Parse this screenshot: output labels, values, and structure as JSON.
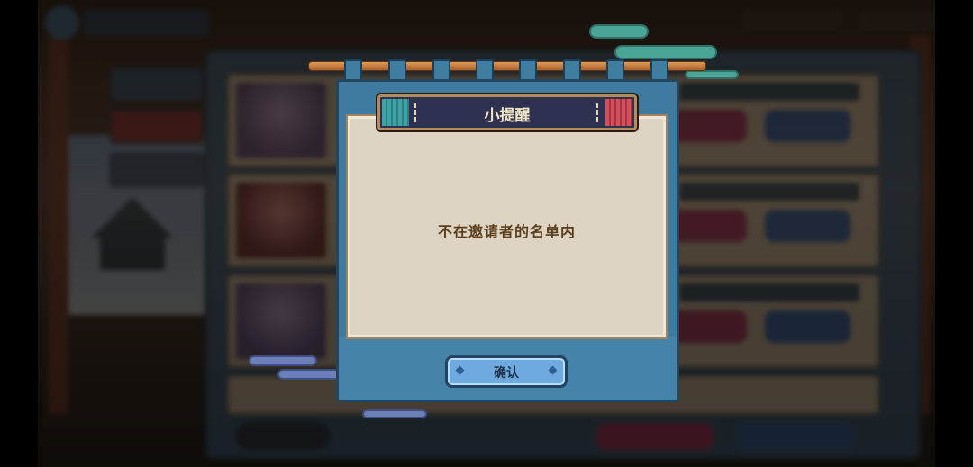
{
  "dialog": {
    "title": "小提醒",
    "message": "不在邀请者的名单内",
    "confirm_label": "确认"
  },
  "colors": {
    "dialog_frame": "#3f7aa0",
    "plaque": "#2f3151",
    "confirm_button": "#6ea9e0",
    "message_text": "#5a3d1b"
  },
  "icons": [
    "back-arrow-icon",
    "diamond-icon"
  ]
}
